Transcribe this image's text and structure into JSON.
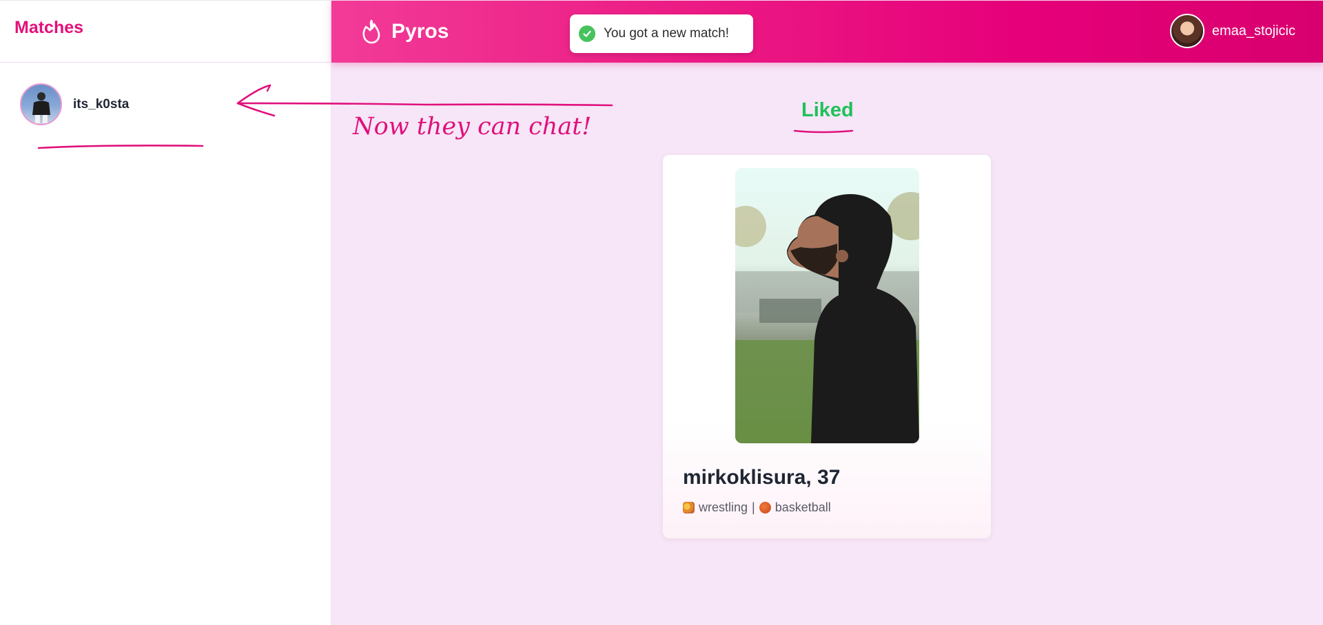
{
  "sidebar": {
    "title": "Matches",
    "matches": [
      {
        "username": "its_k0sta"
      }
    ]
  },
  "header": {
    "brand": "Pyros",
    "toast": "You got a new match!",
    "user": {
      "username": "emaa_stojicic"
    }
  },
  "main": {
    "section_title": "Liked",
    "card": {
      "name_age": "mirkoklisura, 37",
      "interests": [
        {
          "label": "wrestling",
          "icon": "wrestling-emoji-icon"
        },
        {
          "label": "basketball",
          "icon": "basketball-emoji-icon"
        }
      ],
      "separator": "|"
    }
  },
  "annotation": {
    "text": "Now they can chat!"
  },
  "colors": {
    "brand_pink": "#e6007a",
    "liked_green": "#1fc15a",
    "annotation_pink": "#e0107c",
    "background": "#f6e6f7"
  }
}
